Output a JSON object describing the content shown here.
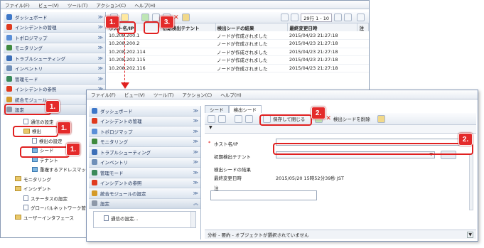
{
  "back": {
    "menu": [
      "ファイル(F)",
      "ビュー(V)",
      "ツール(T)",
      "アクション(C)",
      "ヘルプ(H)"
    ],
    "nav": [
      {
        "label": "ダッシュボード",
        "color": "#3d77c8"
      },
      {
        "label": "インシデントの管理",
        "color": "#e03a1e"
      },
      {
        "label": "トポロジマップ",
        "color": "#5a8fd8"
      },
      {
        "label": "モニタリング",
        "color": "#3f8a3f"
      },
      {
        "label": "トラブルシューティング",
        "color": "#3c6fb8"
      },
      {
        "label": "インベントリ",
        "color": "#6f8fb8"
      },
      {
        "label": "管理モード",
        "color": "#3a8a5a"
      },
      {
        "label": "インシデントの参照",
        "color": "#e03a1e"
      },
      {
        "label": "統合モジュール",
        "color": "#d49a2a"
      }
    ],
    "settings": "設定",
    "tree": [
      "通信の設定",
      "検出",
      "検出の設定",
      "シード",
      "テナント",
      "重複するアドレスマッピング",
      "モニタリング",
      "インシデント",
      "ステータスの設定",
      "グローバルネットワーク管理",
      "ユーザーインタフェース"
    ],
    "pager": "29行 1 - 10",
    "columns": [
      "ホスト名/IP",
      "初期検出テナント",
      "検出シードの結果",
      "最終変更日時",
      "注"
    ],
    "rows": [
      {
        "host": "10.208.200.1",
        "result": "ノードが作成されました",
        "date": "2015/04/23 21:27:18"
      },
      {
        "host": "10.208.200.2",
        "result": "ノードが作成されました",
        "date": "2015/04/23 21:27:18"
      },
      {
        "host": "10.208.202.114",
        "result": "ノードが作成されました",
        "date": "2015/04/23 21:27:18"
      },
      {
        "host": "10.208.202.115",
        "result": "ノードが作成されました",
        "date": "2015/04/23 21:27:18"
      },
      {
        "host": "10.208.202.116",
        "result": "ノードが作成されました",
        "date": "2015/04/23 21:27:18"
      }
    ]
  },
  "front": {
    "menu": [
      "ファイル(F)",
      "ビュー(V)",
      "ツール(T)",
      "アクション(C)",
      "ヘルプ(H)"
    ],
    "nav": [
      {
        "label": "ダッシュボード",
        "color": "#3d77c8"
      },
      {
        "label": "インシデントの管理",
        "color": "#e03a1e"
      },
      {
        "label": "トポロジマップ",
        "color": "#5a8fd8"
      },
      {
        "label": "モニタリング",
        "color": "#3f8a3f"
      },
      {
        "label": "トラブルシューティング",
        "color": "#3c6fb8"
      },
      {
        "label": "インベントリ",
        "color": "#6f8fb8"
      },
      {
        "label": "管理モード",
        "color": "#3a8a5a"
      },
      {
        "label": "インシデントの参照",
        "color": "#e03a1e"
      },
      {
        "label": "統合モジュールの設定",
        "color": "#d49a2a"
      }
    ],
    "settings": "設定",
    "settings_child": "通信の設定...",
    "tabs": [
      "シード",
      "検出シード"
    ],
    "save_close": "保存して閉じる",
    "delete_seed": "検出シードを削除",
    "host_label": "ホスト名/IP",
    "tenant_label": "初期検出テナント",
    "result_label": "検出シードの結果",
    "modified_label": "最終変更日時",
    "modified_value": "2015/05/20 15時52分39秒 JST",
    "note_label": "注",
    "status": "分析 - 要約 - オブジェクトが選択されていません"
  },
  "callouts": [
    "1.",
    "2.",
    "3.",
    "1.",
    "1.",
    "1.",
    "2.",
    "2."
  ]
}
